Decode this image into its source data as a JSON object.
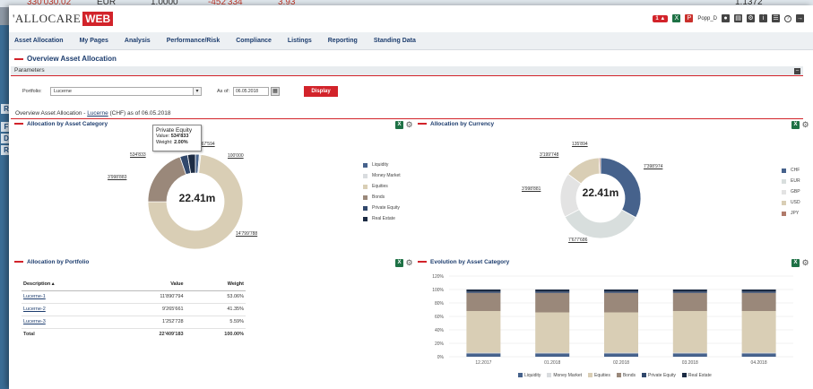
{
  "background": {
    "sheet_cells": [
      "330'030.02",
      "EUR",
      "1.0000",
      "-452'334",
      "3.93",
      "1.1372"
    ],
    "left_letters": [
      "R",
      "F",
      "D",
      "R"
    ]
  },
  "app": {
    "logo_left": "'ALLOCARE",
    "logo_right": "WEB",
    "notif": "1",
    "user": "Popp_D"
  },
  "nav": [
    "Asset Allocation",
    "My Pages",
    "Analysis",
    "Performance/Risk",
    "Compliance",
    "Listings",
    "Reporting",
    "Standing Data"
  ],
  "page": {
    "title": "Overview Asset Allocation",
    "params_label": "Parameters",
    "portfolio_label": "Portfolio:",
    "portfolio_value": "Lucerne",
    "asof_label": "As of:",
    "asof_value": "06.05.2018",
    "display_btn": "Display",
    "subtitle_prefix": "Overview Asset Allocation - ",
    "subtitle_link": "Lucerne",
    "subtitle_suffix": " (CHF) as of 06.05.2018"
  },
  "colors": {
    "accent": "#d2232a",
    "liquidity": "#46628c",
    "money_market": "#d9dcdf",
    "equities": "#d9ceb5",
    "bonds": "#9a887a",
    "private_equity": "#31486c",
    "real_estate": "#1c2b43"
  },
  "asset_category": {
    "title": "Allocation by Asset Category",
    "center": "22.41m",
    "labels": [
      "267'594",
      "100'000",
      "14'799'788",
      "3'998'883",
      "534'833"
    ],
    "tooltip": {
      "title": "Private Equity",
      "value_label": "Value:",
      "value": "534'833",
      "weight_label": "Weight:",
      "weight": "2.00%"
    },
    "chart_data": {
      "type": "pie",
      "categories": [
        "Liquidity",
        "Money Market",
        "Equities",
        "Bonds",
        "Private Equity",
        "Real Estate"
      ],
      "values": [
        267594,
        100000,
        14799788,
        3998883,
        534833,
        534833
      ]
    }
  },
  "currency": {
    "title": "Allocation by Currency",
    "center": "22.41m",
    "labels": [
      "135'894",
      "3'199'748",
      "7'398'974",
      "3'998'881",
      "7'677'686"
    ],
    "legend": [
      "CHF",
      "EUR",
      "GBP",
      "USD",
      "JPY"
    ],
    "chart_data": {
      "type": "pie",
      "categories": [
        "CHF",
        "EUR",
        "GBP",
        "USD",
        "JPY"
      ],
      "values": [
        7398974,
        7677686,
        3998881,
        3199748,
        135894
      ]
    }
  },
  "asset_legend": [
    "Liquidity",
    "Money Market",
    "Equities",
    "Bonds",
    "Private Equity",
    "Real Estate"
  ],
  "portfolio": {
    "title": "Allocation by Portfolio",
    "headers": [
      "Description ▴",
      "Value",
      "Weight"
    ],
    "rows": [
      [
        "Lucerne-1",
        "11'890'794",
        "53.06%"
      ],
      [
        "Lucerne-2",
        "9'265'661",
        "41.35%"
      ],
      [
        "Lucerne-3",
        "1'252'728",
        "5.59%"
      ]
    ],
    "total": [
      "Total",
      "22'409'183",
      "100.00%"
    ]
  },
  "evolution": {
    "title": "Evolution by Asset Category",
    "y_ticks": [
      "120%",
      "100%",
      "80%",
      "60%",
      "40%",
      "20%",
      "0%"
    ],
    "chart_data": {
      "type": "bar",
      "stacked": true,
      "categories": [
        "12.2017",
        "01.2018",
        "02.2018",
        "03.2018",
        "04.2018"
      ],
      "ylim": [
        0,
        120
      ],
      "series": [
        {
          "name": "Liquidity",
          "values": [
            5,
            5,
            5,
            5,
            5
          ]
        },
        {
          "name": "Money Market",
          "values": [
            1,
            1,
            1,
            1,
            1
          ]
        },
        {
          "name": "Equities",
          "values": [
            62,
            60,
            60,
            62,
            62
          ]
        },
        {
          "name": "Bonds",
          "values": [
            27,
            29,
            29,
            27,
            27
          ]
        },
        {
          "name": "Private Equity",
          "values": [
            2,
            2,
            2,
            2,
            2
          ]
        },
        {
          "name": "Real Estate",
          "values": [
            3,
            3,
            3,
            3,
            3
          ]
        }
      ]
    }
  }
}
